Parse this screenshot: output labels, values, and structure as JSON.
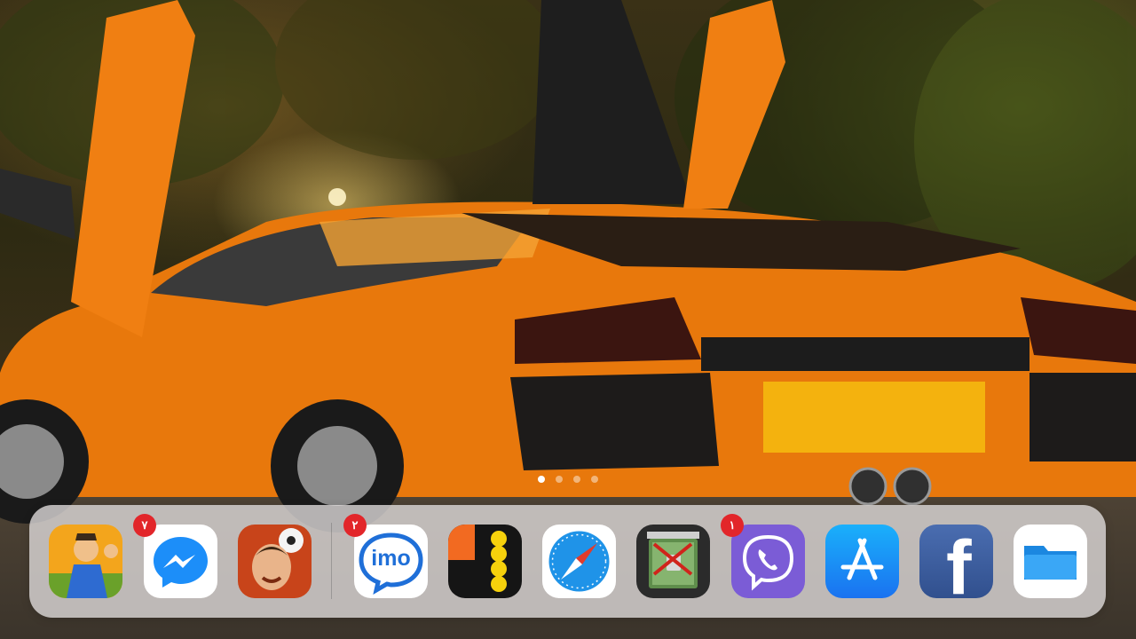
{
  "page_dots": {
    "count": 4,
    "active_index": 0
  },
  "dock": {
    "apps": [
      {
        "id": "game-brawl",
        "icon": "game-character-icon",
        "badge": ""
      },
      {
        "id": "messenger",
        "icon": "messenger-icon",
        "badge": "٧"
      },
      {
        "id": "game-soccer",
        "icon": "soccer-game-icon",
        "badge": ""
      },
      {
        "id": "imo",
        "icon": "imo-icon",
        "badge": "٢",
        "label": "imo"
      },
      {
        "id": "yellow-dots",
        "icon": "dots-app-icon",
        "badge": ""
      },
      {
        "id": "safari",
        "icon": "safari-compass-icon",
        "badge": ""
      },
      {
        "id": "vault",
        "icon": "vault-lock-icon",
        "badge": ""
      },
      {
        "id": "viber",
        "icon": "viber-phone-icon",
        "badge": "١"
      },
      {
        "id": "app-store",
        "icon": "app-store-icon",
        "badge": ""
      },
      {
        "id": "facebook",
        "icon": "facebook-icon",
        "badge": "",
        "label": "f"
      },
      {
        "id": "files",
        "icon": "files-folder-icon",
        "badge": ""
      }
    ]
  },
  "colors": {
    "badge": "#e2262a",
    "messenger": "#1c8ef9",
    "imo": "#1f6fd8",
    "viber": "#7b5cd6",
    "app_store": "#1d8ff4",
    "facebook": "#3b5a9a",
    "files": "#2a9df4"
  }
}
